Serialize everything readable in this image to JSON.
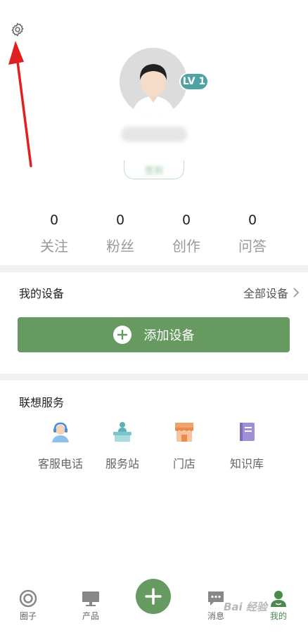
{
  "profile": {
    "level": "LV 1"
  },
  "stats": [
    {
      "count": "0",
      "label": "关注"
    },
    {
      "count": "0",
      "label": "粉丝"
    },
    {
      "count": "0",
      "label": "创作"
    },
    {
      "count": "0",
      "label": "问答"
    }
  ],
  "devices": {
    "title": "我的设备",
    "all_label": "全部设备",
    "add_label": "添加设备"
  },
  "services": {
    "title": "联想服务",
    "items": [
      {
        "label": "客服电话",
        "icon": "customer-service-icon"
      },
      {
        "label": "服务站",
        "icon": "service-station-icon"
      },
      {
        "label": "门店",
        "icon": "store-icon"
      },
      {
        "label": "知识库",
        "icon": "knowledge-base-icon"
      }
    ]
  },
  "tabbar": {
    "items": [
      {
        "label": "圈子",
        "icon": "circle-icon"
      },
      {
        "label": "产品",
        "icon": "monitor-icon"
      },
      {
        "label": "消息",
        "icon": "message-icon"
      },
      {
        "label": "我的",
        "icon": "profile-icon"
      }
    ]
  },
  "watermark": "Bai 经验",
  "colors": {
    "brand_green": "#679a60",
    "badge_teal": "#4fa3a3",
    "arrow_red": "#e02020"
  }
}
